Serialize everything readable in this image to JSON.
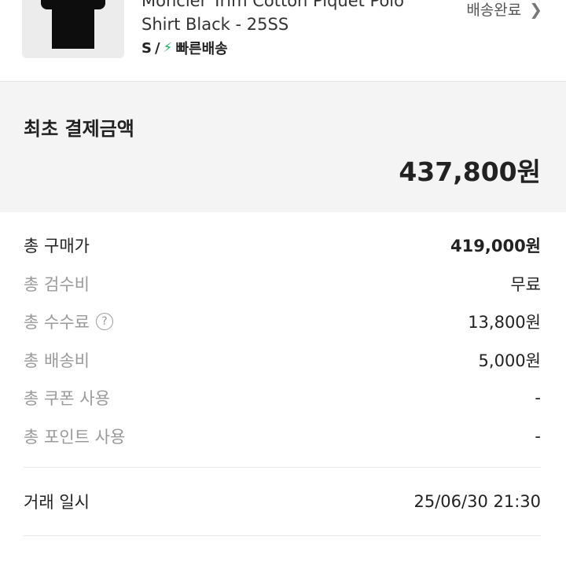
{
  "product": {
    "image_icon": "black-polo-shirt-image",
    "name_line1": "Moncler Trim Cotton Piquet Polo",
    "name_line2": "Shirt Black - 25SS",
    "size": "S",
    "separator": "/",
    "bolt_icon": "lightning-bolt-icon",
    "shipping_type": "빠른배송",
    "status": "배송완료",
    "status_icon": "chevron-right-icon"
  },
  "payment": {
    "label": "최초 결제금액",
    "amount": "437,800원"
  },
  "breakdown": [
    {
      "label": "총 구매가",
      "value": "419,000원"
    },
    {
      "label": "총 검수비",
      "value": "무료"
    },
    {
      "label": "총 수수료",
      "value": "13,800원",
      "help": "?"
    },
    {
      "label": "총 배송비",
      "value": "5,000원"
    },
    {
      "label": "총 쿠폰 사용",
      "value": "-"
    },
    {
      "label": "총 포인트 사용",
      "value": "-"
    }
  ],
  "trade": {
    "label": "거래 일시",
    "value": "25/06/30 21:30"
  },
  "colors": {
    "accent_green": "#28b46b",
    "summary_bg": "#f4f4f4",
    "muted_text": "#9a9a9a"
  }
}
